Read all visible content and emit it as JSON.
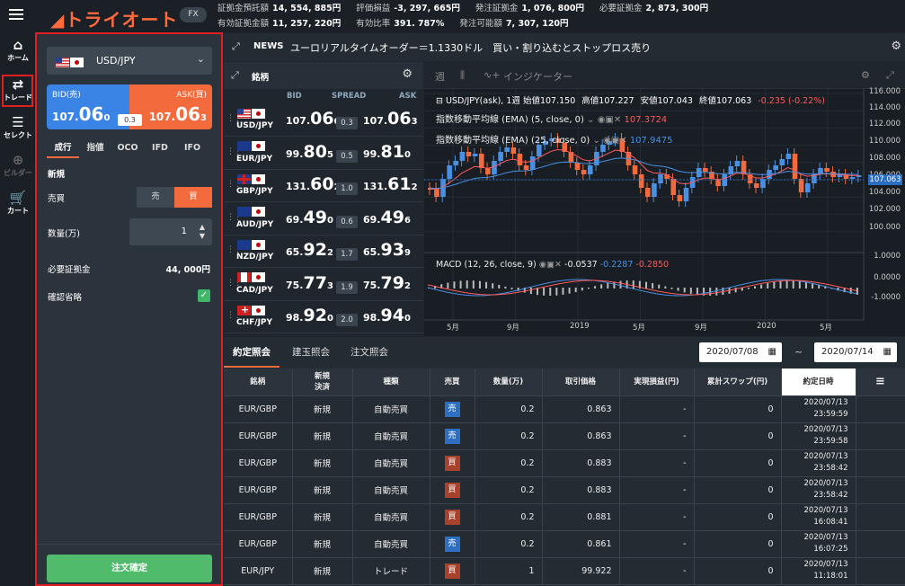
{
  "app": {
    "logo": "トライオート",
    "product_badge": "FX"
  },
  "account": {
    "row1": [
      {
        "label": "証拠金預託額",
        "value": "14, 554, 885円"
      },
      {
        "label": "評価損益",
        "value": "-3, 297, 665円"
      },
      {
        "label": "発注証拠金",
        "value": "1, 076, 800円"
      },
      {
        "label": "必要証拠金",
        "value": "2, 873, 300円"
      }
    ],
    "row2": [
      {
        "label": "有効証拠金額",
        "value": "11, 257, 220円"
      },
      {
        "label": "有効比率",
        "value": "391. 787%"
      },
      {
        "label": "発注可能額",
        "value": "7, 307, 120円"
      }
    ]
  },
  "sidenav": [
    {
      "label": "ホーム",
      "icon": "home-icon"
    },
    {
      "label": "トレード",
      "icon": "trade-icon"
    },
    {
      "label": "セレクト",
      "icon": "select-icon"
    },
    {
      "label": "ビルダー",
      "icon": "builder-icon"
    },
    {
      "label": "カート",
      "icon": "cart-icon"
    }
  ],
  "order": {
    "pair": "USD/JPY",
    "bid_label": "BID(売)",
    "ask_label": "ASK(買)",
    "bid": {
      "head": "107.",
      "big": "06",
      "pip": "0"
    },
    "ask": {
      "head": "107.",
      "big": "06",
      "pip": "3"
    },
    "spread": "0.3",
    "tabs": [
      "成行",
      "指値",
      "OCO",
      "IFD",
      "IFO"
    ],
    "section_new": "新規",
    "side_label": "売買",
    "sell_label": "売",
    "buy_label": "買",
    "qty_label": "数量(万)",
    "qty_value": "1",
    "margin_label": "必要証拠金",
    "margin_value": "44, 000円",
    "confirm_label": "確認省略",
    "submit_label": "注文確定"
  },
  "news": {
    "label": "NEWS",
    "text": "ユーロリアルタイムオーダー＝1.1330ドル　買い・割り込むとストップロス売り"
  },
  "rates": {
    "title": "銘柄",
    "cols": {
      "bid": "BID",
      "spread": "SPREAD",
      "ask": "ASK"
    },
    "rows": [
      {
        "sym": "USD/JPY",
        "f1": "us",
        "f2": "jp",
        "bid_h": "107.",
        "bid_b": "06",
        "bid_p": "0",
        "spread": "0.3",
        "ask_h": "107.",
        "ask_b": "06",
        "ask_p": "3"
      },
      {
        "sym": "EUR/JPY",
        "f1": "eu",
        "f2": "jp",
        "bid_h": "99.",
        "bid_b": "80",
        "bid_p": "5",
        "spread": "0.5",
        "ask_h": "99.",
        "ask_b": "81",
        "ask_p": "0"
      },
      {
        "sym": "GBP/JPY",
        "f1": "gb",
        "f2": "jp",
        "bid_h": "131.",
        "bid_b": "60",
        "bid_p": "2",
        "spread": "1.0",
        "ask_h": "131.",
        "ask_b": "61",
        "ask_p": "2"
      },
      {
        "sym": "AUD/JPY",
        "f1": "au",
        "f2": "jp",
        "bid_h": "69.",
        "bid_b": "49",
        "bid_p": "0",
        "spread": "0.6",
        "ask_h": "69.",
        "ask_b": "49",
        "ask_p": "6"
      },
      {
        "sym": "NZD/JPY",
        "f1": "nz",
        "f2": "jp",
        "bid_h": "65.",
        "bid_b": "92",
        "bid_p": "2",
        "spread": "1.7",
        "ask_h": "65.",
        "ask_b": "93",
        "ask_p": "9"
      },
      {
        "sym": "CAD/JPY",
        "f1": "ca",
        "f2": "jp",
        "bid_h": "75.",
        "bid_b": "77",
        "bid_p": "3",
        "spread": "1.9",
        "ask_h": "75.",
        "ask_b": "79",
        "ask_p": "2"
      },
      {
        "sym": "CHF/JPY",
        "f1": "ch",
        "f2": "jp",
        "bid_h": "98.",
        "bid_b": "92",
        "bid_p": "0",
        "spread": "2.0",
        "ask_h": "98.",
        "ask_b": "94",
        "ask_p": "0"
      }
    ]
  },
  "chart": {
    "interval": "週",
    "indicator_btn": "インジケーター",
    "legend": {
      "symbol": "USD/JPY(ask), 1週",
      "open_k": "始値",
      "open": "107.150",
      "high_k": "高値",
      "high": "107.227",
      "low_k": "安値",
      "low": "107.043",
      "close_k": "終値",
      "close": "107.063",
      "chg": "-0.235 (-0.22%)"
    },
    "ema5": {
      "label": "指数移動平均線 (EMA) (5, close, 0)",
      "value": "107.3724"
    },
    "ema25": {
      "label": "指数移動平均線 (EMA) (25, close, 0)",
      "value": "107.9475"
    },
    "macd": {
      "label": "MACD (12, 26, close, 9)",
      "v1": "-0.0537",
      "v2": "-0.2287",
      "v3": "-0.2850"
    },
    "y_price": [
      "116.000",
      "114.000",
      "112.000",
      "110.000",
      "108.000",
      "106.000",
      "104.000",
      "102.000",
      "100.000"
    ],
    "y_macd": [
      "1.0000",
      "0.0000",
      "-1.0000"
    ],
    "last_price": "107.063",
    "x_labels": [
      "5月",
      "9月",
      "2019",
      "5月",
      "9月",
      "2020",
      "5月"
    ],
    "colors": {
      "up": "#4a90e2",
      "down": "#f36a3c"
    }
  },
  "history": {
    "tabs": [
      "約定照会",
      "建玉照会",
      "注文照会"
    ],
    "date_from": "2020/07/08",
    "date_to": "2020/07/14",
    "tilde": "~",
    "headers": [
      "銘柄",
      "新規\n決済",
      "種類",
      "売買",
      "数量(万)",
      "取引価格",
      "実現損益(円)",
      "累計スワップ(円)",
      "約定日時"
    ],
    "rows": [
      {
        "sym": "EUR/GBP",
        "nk": "新規",
        "kind": "自動売買",
        "side": "売",
        "sideType": "sell",
        "qty": "0.2",
        "price": "0.863",
        "pl": "-",
        "swap": "0",
        "date": "2020/07/13",
        "time": "23:59:59"
      },
      {
        "sym": "EUR/GBP",
        "nk": "新規",
        "kind": "自動売買",
        "side": "売",
        "sideType": "sell",
        "qty": "0.2",
        "price": "0.863",
        "pl": "-",
        "swap": "0",
        "date": "2020/07/13",
        "time": "23:59:58"
      },
      {
        "sym": "EUR/GBP",
        "nk": "新規",
        "kind": "自動売買",
        "side": "買",
        "sideType": "buy",
        "qty": "0.2",
        "price": "0.883",
        "pl": "-",
        "swap": "0",
        "date": "2020/07/13",
        "time": "23:58:42"
      },
      {
        "sym": "EUR/GBP",
        "nk": "新規",
        "kind": "自動売買",
        "side": "買",
        "sideType": "buy",
        "qty": "0.2",
        "price": "0.883",
        "pl": "-",
        "swap": "0",
        "date": "2020/07/13",
        "time": "23:58:42"
      },
      {
        "sym": "EUR/GBP",
        "nk": "新規",
        "kind": "自動売買",
        "side": "買",
        "sideType": "buy",
        "qty": "0.2",
        "price": "0.881",
        "pl": "-",
        "swap": "0",
        "date": "2020/07/13",
        "time": "16:08:41"
      },
      {
        "sym": "EUR/GBP",
        "nk": "新規",
        "kind": "自動売買",
        "side": "売",
        "sideType": "sell",
        "qty": "0.2",
        "price": "0.861",
        "pl": "-",
        "swap": "0",
        "date": "2020/07/13",
        "time": "16:07:25"
      },
      {
        "sym": "EUR/JPY",
        "nk": "新規",
        "kind": "トレード",
        "side": "買",
        "sideType": "buy",
        "qty": "1",
        "price": "99.922",
        "pl": "-",
        "swap": "0",
        "date": "2020/07/13",
        "time": "11:18:01"
      }
    ]
  }
}
